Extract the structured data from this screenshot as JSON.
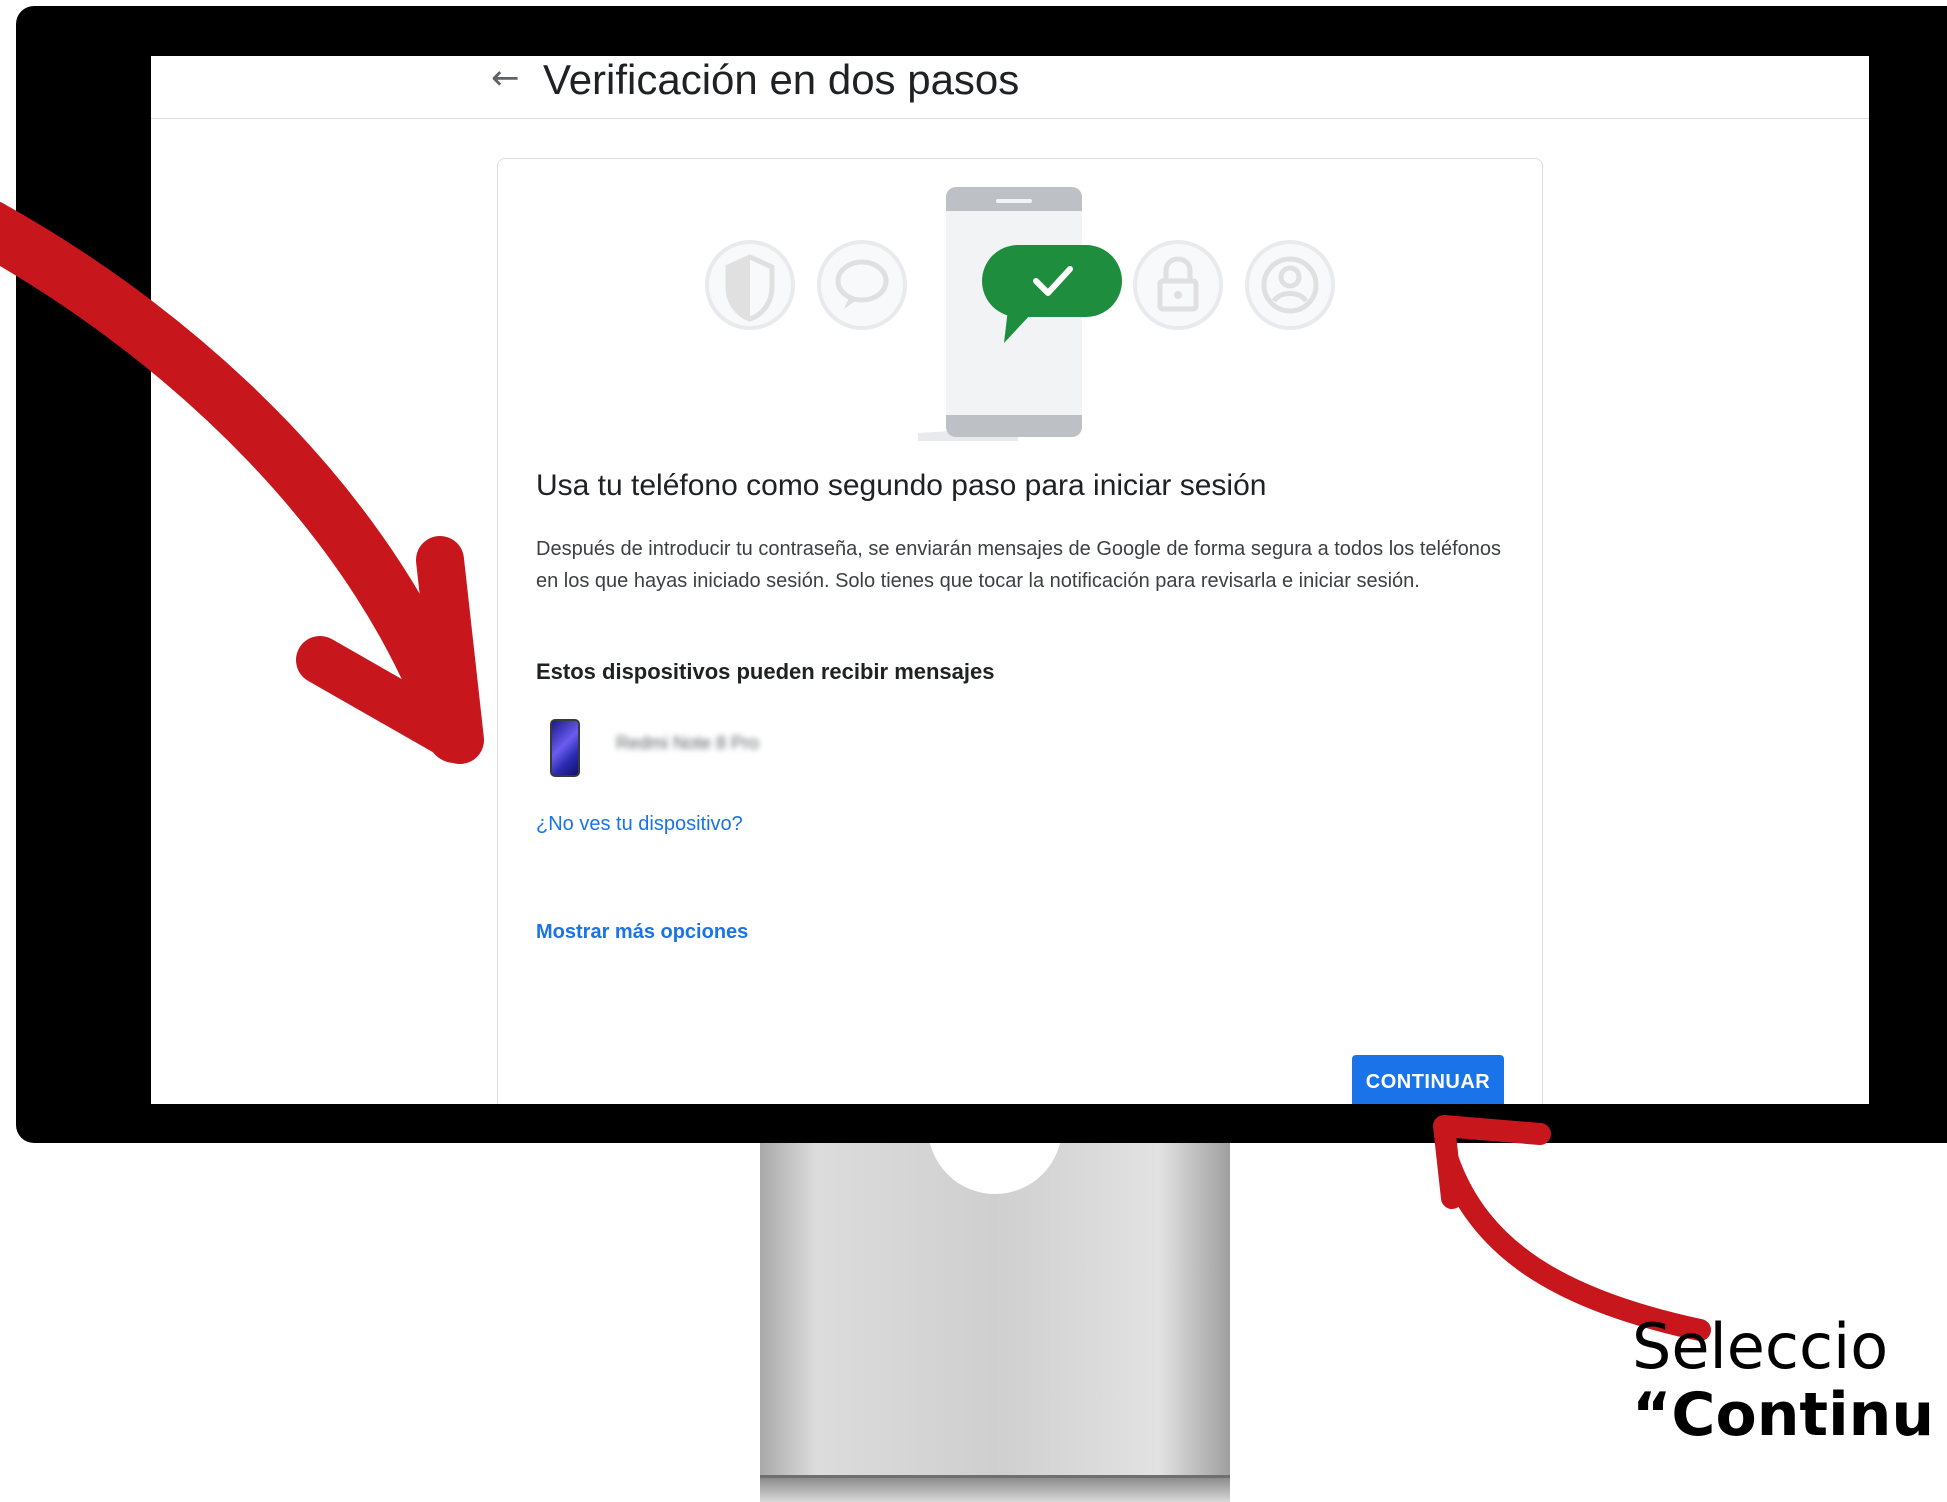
{
  "header": {
    "back_icon": "arrow-left-icon",
    "title": "Verificación en dos pasos"
  },
  "card": {
    "heading": "Usa tu teléfono como segundo paso para iniciar sesión",
    "description": "Después de introducir tu contraseña, se enviarán mensajes de Google de forma segura a todos los teléfonos en los que hayas iniciado sesión. Solo tienes que tocar la notificación para revisarla e iniciar sesión.",
    "devices_title": "Estos dispositivos pueden recibir mensajes",
    "device": {
      "icon": "phone-icon",
      "name": "Redmi Note 8 Pro"
    },
    "link_missing_device": "¿No ves tu dispositivo?",
    "link_more_options": "Mostrar más opciones",
    "continue_label": "CONTINUAR"
  },
  "illustration": {
    "icons": [
      "shield-icon",
      "chat-icon",
      "check-bubble-icon",
      "lock-icon",
      "account-icon"
    ]
  },
  "caption": {
    "line1": "Seleccio",
    "line2": "“Continu"
  },
  "colors": {
    "accent": "#1a73e8",
    "check_bubble": "#1e8e3e",
    "arrow": "#c8161d"
  }
}
